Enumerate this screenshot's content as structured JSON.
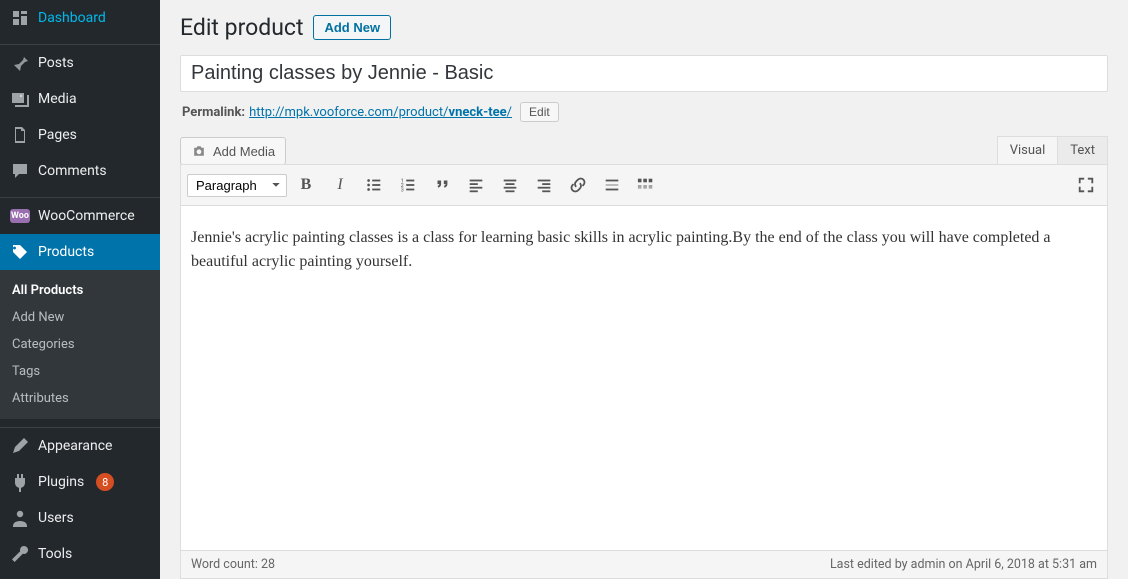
{
  "sidebar": {
    "dashboard": "Dashboard",
    "posts": "Posts",
    "media": "Media",
    "pages": "Pages",
    "comments": "Comments",
    "woocommerce": "WooCommerce",
    "products": "Products",
    "appearance": "Appearance",
    "plugins": "Plugins",
    "plugins_count": "8",
    "users": "Users",
    "tools": "Tools"
  },
  "submenu": {
    "all": "All Products",
    "addnew": "Add New",
    "categories": "Categories",
    "tags": "Tags",
    "attributes": "Attributes"
  },
  "head": {
    "title": "Edit product",
    "addnew": "Add New"
  },
  "product": {
    "title": "Painting classes by Jennie - Basic"
  },
  "permalink": {
    "label": "Permalink:",
    "base": "http://mpk.vooforce.com/product/",
    "slug": "vneck-tee",
    "trail": "/",
    "edit": "Edit"
  },
  "media_btn": "Add Media",
  "tabs": {
    "visual": "Visual",
    "text": "Text"
  },
  "toolbar": {
    "format": "Paragraph"
  },
  "content": "Jennie's acrylic painting classes is a class for learning basic skills in acrylic painting.By the end of the class you will have completed a beautiful acrylic painting yourself.",
  "footer": {
    "wordcount": "Word count: 28",
    "lastedit": "Last edited by admin on April 6, 2018 at 5:31 am"
  }
}
